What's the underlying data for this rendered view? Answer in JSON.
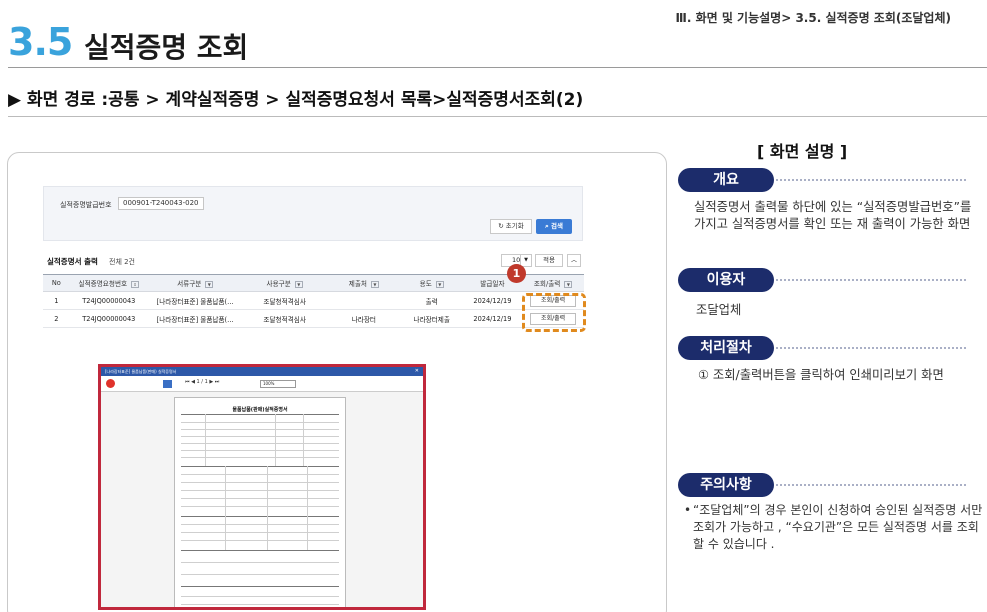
{
  "header": {
    "breadcrumb": "Ⅲ. 화면 및 기능설명> 3.5. 실적증명 조회(조달업체)",
    "section_number": "3.5",
    "section_title": "실적증명 조회",
    "path": "▶ 화면 경로 :공통 > 계약실적증명 > 실적증명요청서 목록>실적증명서조회(2)"
  },
  "search": {
    "label": "실적증명발급번호",
    "value": "000901-T240043-020",
    "reset_label": "초기화",
    "search_label": "검색"
  },
  "list": {
    "title": "실적증명서 출력",
    "total": "전체 2건",
    "page_size": "10",
    "apply_label": "적용",
    "collapse_icon": "chevron-up-icon",
    "columns": [
      "No",
      "실적증명요청번호",
      "서류구분",
      "사용구분",
      "제출처",
      "용도",
      "발급일자",
      "조회/출력"
    ],
    "rows": [
      {
        "no": "1",
        "req_no": "T24JQ00000043",
        "doc_type": "[나라장터표준] 물품납품(…",
        "use_type": "조달청적격심사",
        "submit_to": "",
        "purpose": "출력",
        "issue_date": "2024/12/19",
        "action": "조회/출력"
      },
      {
        "no": "2",
        "req_no": "T24JQ00000043",
        "doc_type": "[나라장터표준] 물품납품(…",
        "use_type": "조달청적격심사",
        "submit_to": "나라장터",
        "purpose": "나라장터제출",
        "issue_date": "2024/12/19",
        "action": "조회/출력"
      }
    ]
  },
  "callout": {
    "number": "1"
  },
  "preview": {
    "window_title": "[나라장터표준] 물품납품(판매) 실적증명서",
    "zoom": "100%",
    "nav": "⏮ ◀  1 / 1  ▶ ⏭",
    "doc_title": "물품납품(판매)실적증명서"
  },
  "right": {
    "title": "[ 화면 설명 ]",
    "overview_label": "개요",
    "overview_text": "실적증명서 출력물 하단에 있는 “실적증명발급번호”를 가지고 실적증명서를 확인 또는 재 출력이 가능한 화면",
    "user_label": "이용자",
    "user_text": "조달업체",
    "process_label": "처리절차",
    "process_text": "① 조회/출력버튼을 클릭하여 인쇄미리보기 화면",
    "caution_label": "주의사항",
    "caution_text": "“조달업체”의 경우 본인이 신청하여 승인된 실적증명 서만 조회가 가능하고 , “수요기관”은 모든 실적증명 서를 조회할 수 있습니다 .",
    "colors": {
      "pill": "#1c2c6b",
      "accent": "#3aa3dc",
      "highlight": "#e08a1e",
      "frame": "#c0283c"
    }
  }
}
